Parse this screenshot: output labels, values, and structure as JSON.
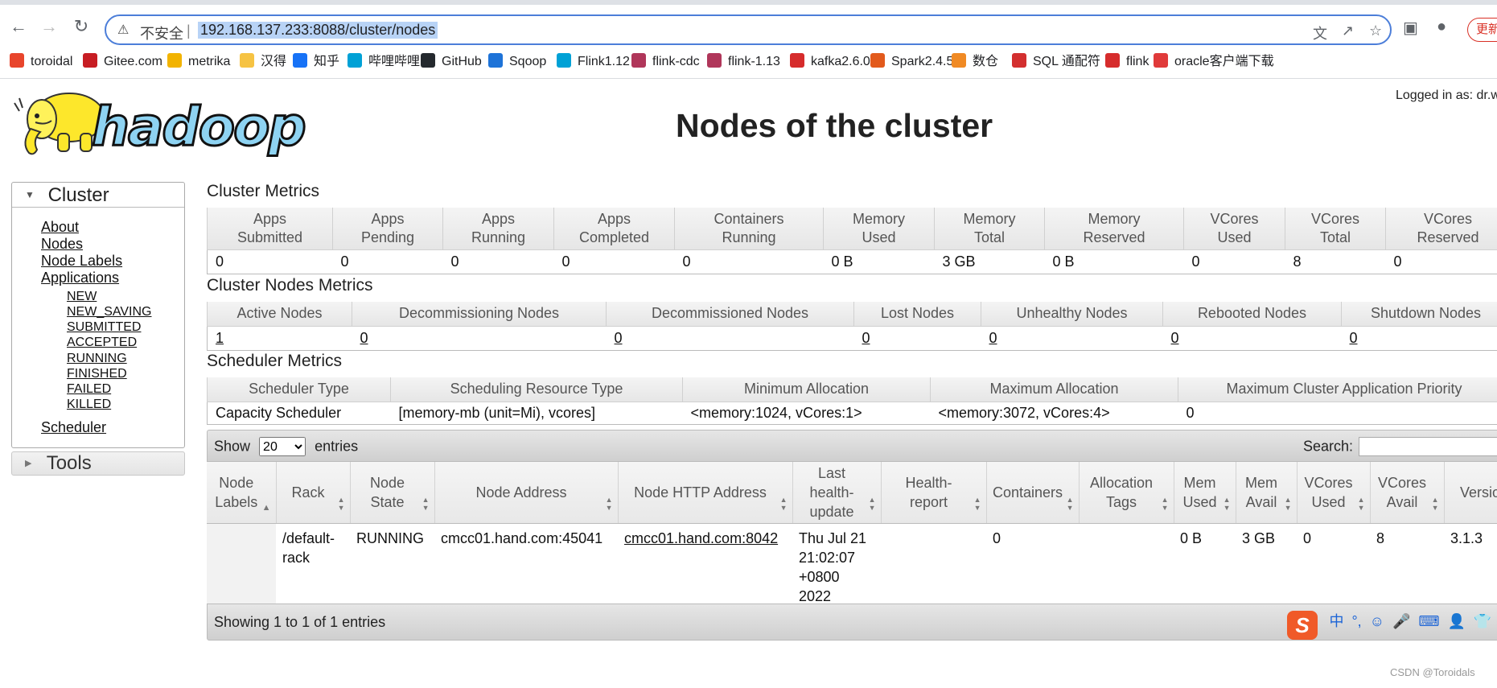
{
  "browser": {
    "insecure_label": "不安全",
    "separator": "|",
    "url": "192.168.137.233:8088/cluster/nodes",
    "update_label": "更新",
    "bookmarks": [
      {
        "label": "toroidal",
        "icon": "toroidal-icon",
        "color": "#e8452c"
      },
      {
        "label": "Gitee.com",
        "icon": "gitee-icon",
        "color": "#c71d23"
      },
      {
        "label": "metrika",
        "icon": "metrika-icon",
        "color": "#f2b300"
      },
      {
        "label": "汉得",
        "icon": "folder-icon",
        "color": "#f6c343"
      },
      {
        "label": "知乎",
        "icon": "zhihu-icon",
        "color": "#1772f6"
      },
      {
        "label": "哔哩哔哩",
        "icon": "bilibili-icon",
        "color": "#00a1d6"
      },
      {
        "label": "GitHub",
        "icon": "github-icon",
        "color": "#24292e"
      },
      {
        "label": "Sqoop",
        "icon": "sqoop-icon",
        "color": "#1e73d8"
      },
      {
        "label": "Flink1.12",
        "icon": "bilibili-icon",
        "color": "#00a1d6"
      },
      {
        "label": "flink-cdc",
        "icon": "squirrel-icon",
        "color": "#b0365a"
      },
      {
        "label": "flink-1.13",
        "icon": "squirrel-icon",
        "color": "#b0365a"
      },
      {
        "label": "kafka2.6.0",
        "icon": "feather-icon",
        "color": "#d62c2c"
      },
      {
        "label": "Spark2.4.5",
        "icon": "spark-icon",
        "color": "#e25a1c"
      },
      {
        "label": "数仓",
        "icon": "bracket-icon",
        "color": "#f08a24"
      },
      {
        "label": "SQL 通配符",
        "icon": "sql-icon",
        "color": "#d32f2f"
      },
      {
        "label": "flink",
        "icon": "feather-icon",
        "color": "#d62c2c"
      },
      {
        "label": "oracle客户端下载",
        "icon": "oracle-icon",
        "color": "#e03a3a"
      }
    ]
  },
  "header": {
    "logged_in": "Logged in as: dr.who",
    "title": "Nodes of the cluster"
  },
  "sidebar": {
    "cluster_label": "Cluster",
    "links": [
      "About",
      "Nodes",
      "Node Labels",
      "Applications"
    ],
    "app_states": [
      "NEW",
      "NEW_SAVING",
      "SUBMITTED",
      "ACCEPTED",
      "RUNNING",
      "FINISHED",
      "FAILED",
      "KILLED"
    ],
    "scheduler": "Scheduler",
    "tools_label": "Tools"
  },
  "cluster_metrics": {
    "title": "Cluster Metrics",
    "headers": [
      [
        "Apps",
        "Submitted"
      ],
      [
        "Apps",
        "Pending"
      ],
      [
        "Apps",
        "Running"
      ],
      [
        "Apps",
        "Completed"
      ],
      [
        "Containers",
        "Running"
      ],
      [
        "Memory",
        "Used"
      ],
      [
        "Memory",
        "Total"
      ],
      [
        "Memory",
        "Reserved"
      ],
      [
        "VCores",
        "Used"
      ],
      [
        "VCores",
        "Total"
      ],
      [
        "VCores",
        "Reserved"
      ]
    ],
    "values": [
      "0",
      "0",
      "0",
      "0",
      "0",
      "0 B",
      "3 GB",
      "0 B",
      "0",
      "8",
      "0"
    ]
  },
  "node_metrics": {
    "title": "Cluster Nodes Metrics",
    "headers": [
      "Active Nodes",
      "Decommissioning Nodes",
      "Decommissioned Nodes",
      "Lost Nodes",
      "Unhealthy Nodes",
      "Rebooted Nodes",
      "Shutdown Nodes"
    ],
    "values": [
      "1",
      "0",
      "0",
      "0",
      "0",
      "0",
      "0"
    ]
  },
  "scheduler_metrics": {
    "title": "Scheduler Metrics",
    "headers": [
      "Scheduler Type",
      "Scheduling Resource Type",
      "Minimum Allocation",
      "Maximum Allocation",
      "Maximum Cluster Application Priority"
    ],
    "values": [
      "Capacity Scheduler",
      "[memory-mb (unit=Mi), vcores]",
      "<memory:1024, vCores:1>",
      "<memory:3072, vCores:4>",
      "0"
    ]
  },
  "nodes_table": {
    "show_label": "Show",
    "page_size": "20",
    "entries_label": "entries",
    "search_label": "Search:",
    "headers": [
      [
        "Node",
        "Labels"
      ],
      [
        "Rack"
      ],
      [
        "Node",
        "State"
      ],
      [
        "Node Address"
      ],
      [
        "Node HTTP Address"
      ],
      [
        "Last",
        "health-",
        "update"
      ],
      [
        "Health-",
        "report"
      ],
      [
        "Containers"
      ],
      [
        "Allocation",
        "Tags"
      ],
      [
        "Mem",
        "Used"
      ],
      [
        "Mem",
        "Avail"
      ],
      [
        "VCores",
        "Used"
      ],
      [
        "VCores",
        "Avail"
      ],
      [
        "Version"
      ]
    ],
    "row": {
      "labels": "",
      "rack": [
        "/default-",
        "rack"
      ],
      "state": "RUNNING",
      "address": "cmcc01.hand.com:45041",
      "http_address": "cmcc01.hand.com:8042",
      "last_update": [
        "Thu Jul 21",
        "21:02:07",
        "+0800",
        "2022"
      ],
      "health_report": "",
      "containers": "0",
      "allocation_tags": "",
      "mem_used": "0 B",
      "mem_avail": "3 GB",
      "vcores_used": "0",
      "vcores_avail": "8",
      "version": "3.1.3"
    },
    "info": "Showing 1 to 1 of 1 entries"
  },
  "ime": {
    "logo": "S",
    "items": [
      "中",
      "°,",
      "☺",
      "🎤",
      "⌨",
      "👤",
      "👕"
    ]
  },
  "watermark": "CSDN @Toroidals"
}
